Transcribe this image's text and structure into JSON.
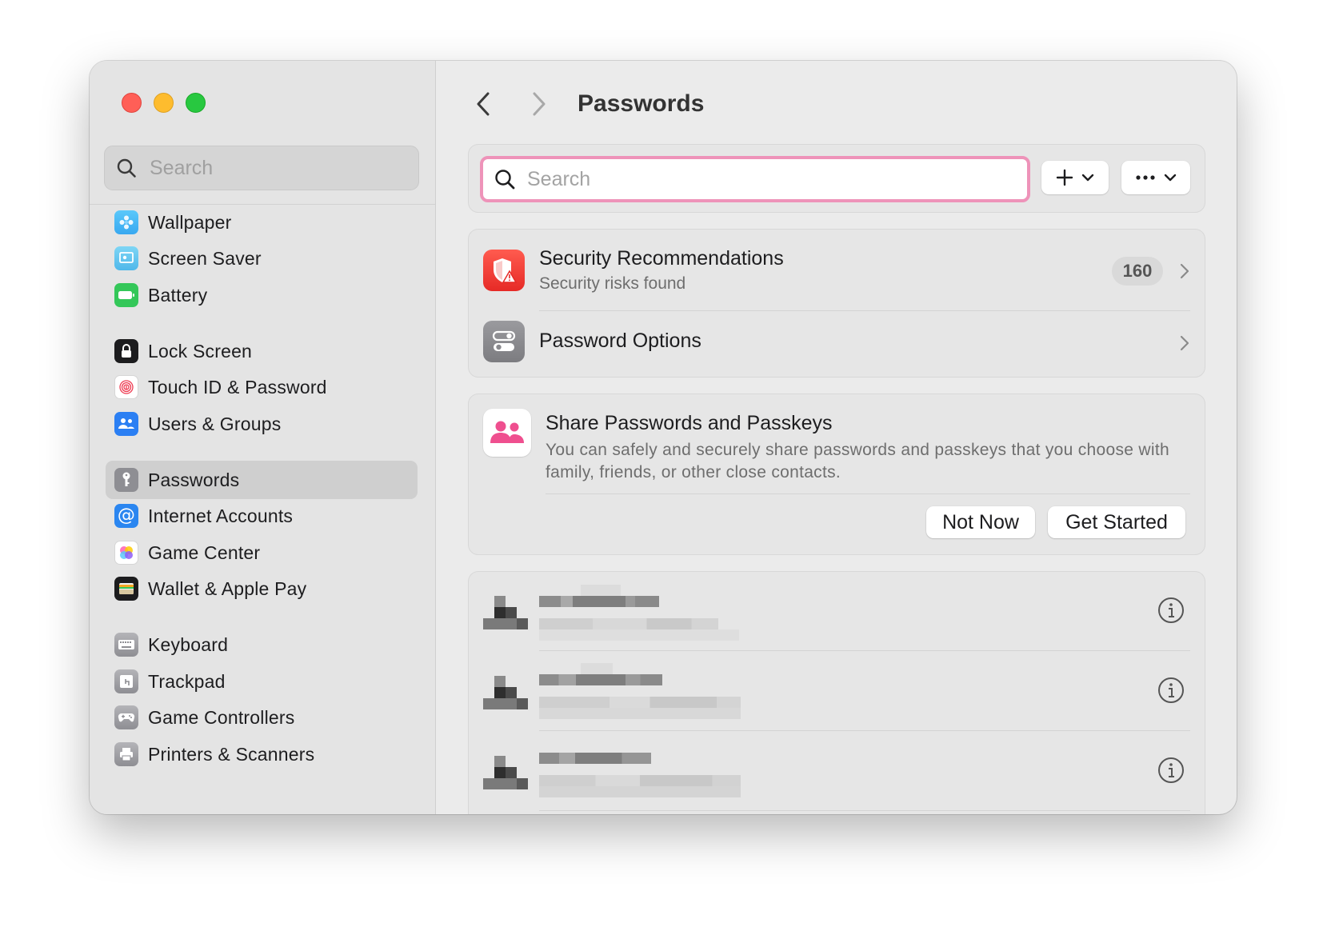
{
  "sidebar": {
    "search_placeholder": "Search",
    "items": [
      {
        "label": "Wallpaper",
        "icon": "wallpaper-icon"
      },
      {
        "label": "Screen Saver",
        "icon": "screen-saver-icon"
      },
      {
        "label": "Battery",
        "icon": "battery-icon"
      },
      {
        "label": "Lock Screen",
        "icon": "lock-icon"
      },
      {
        "label": "Touch ID & Password",
        "icon": "fingerprint-icon"
      },
      {
        "label": "Users & Groups",
        "icon": "users-icon"
      },
      {
        "label": "Passwords",
        "icon": "key-icon",
        "selected": true
      },
      {
        "label": "Internet Accounts",
        "icon": "at-sign-icon"
      },
      {
        "label": "Game Center",
        "icon": "game-center-icon"
      },
      {
        "label": "Wallet & Apple Pay",
        "icon": "wallet-icon"
      },
      {
        "label": "Keyboard",
        "icon": "keyboard-icon"
      },
      {
        "label": "Trackpad",
        "icon": "trackpad-icon"
      },
      {
        "label": "Game Controllers",
        "icon": "gamepad-icon"
      },
      {
        "label": "Printers & Scanners",
        "icon": "printer-icon"
      }
    ]
  },
  "header": {
    "title": "Passwords"
  },
  "toolbar": {
    "search_placeholder": "Search"
  },
  "security": {
    "title": "Security Recommendations",
    "subtitle": "Security risks found",
    "count": "160"
  },
  "options": {
    "title": "Password Options"
  },
  "share": {
    "title": "Share Passwords and Passkeys",
    "description": "You can safely and securely share passwords and passkeys that you choose with family, friends, or other close contacts.",
    "not_now_label": "Not Now",
    "get_started_label": "Get Started"
  },
  "colors": {
    "accent_focus": "#ee93b9",
    "security_red": "#f23c37",
    "share_pink": "#ef4f8f"
  }
}
